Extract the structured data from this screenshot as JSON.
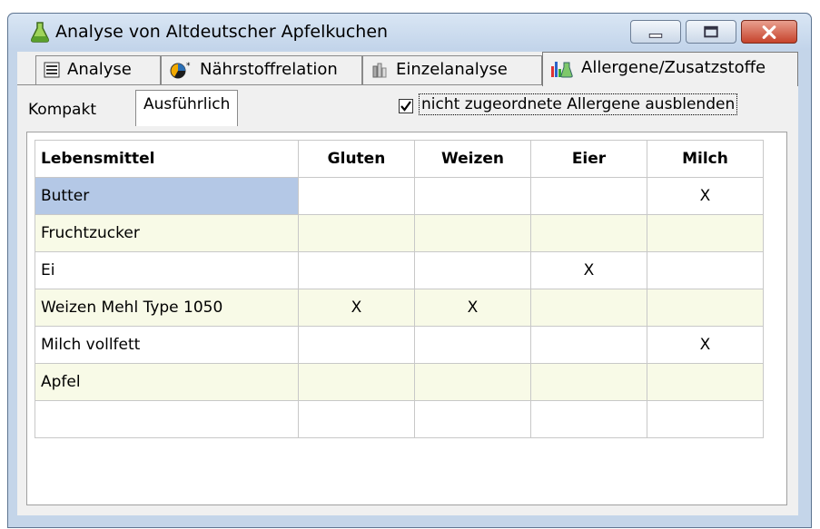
{
  "window": {
    "title": "Analyse von Altdeutscher Apfelkuchen"
  },
  "tabs": [
    {
      "label": "Analyse",
      "icon": "list-icon"
    },
    {
      "label": "Nährstoffrelation",
      "icon": "pie-chart-icon"
    },
    {
      "label": "Einzelanalyse",
      "icon": "bottles-icon"
    },
    {
      "label": "Allergene/Zusatzstoffe",
      "icon": "chart-flask-icon"
    }
  ],
  "subtabs": [
    "Kompakt",
    "Ausführlich"
  ],
  "checkbox": {
    "label": "nicht zugeordnete Allergene ausblenden",
    "checked": true
  },
  "table": {
    "headers": [
      "Lebensmittel",
      "Gluten",
      "Weizen",
      "Eier",
      "Milch"
    ],
    "rows": [
      [
        "Butter",
        "",
        "",
        "",
        "X"
      ],
      [
        "Fruchtzucker",
        "",
        "",
        "",
        ""
      ],
      [
        "Ei",
        "",
        "",
        "X",
        ""
      ],
      [
        "Weizen Mehl Type 1050",
        "X",
        "X",
        "",
        ""
      ],
      [
        "Milch vollfett",
        "",
        "",
        "",
        "X"
      ],
      [
        "Apfel",
        "",
        "",
        "",
        ""
      ],
      [
        "",
        "",
        "",
        "",
        ""
      ]
    ]
  }
}
